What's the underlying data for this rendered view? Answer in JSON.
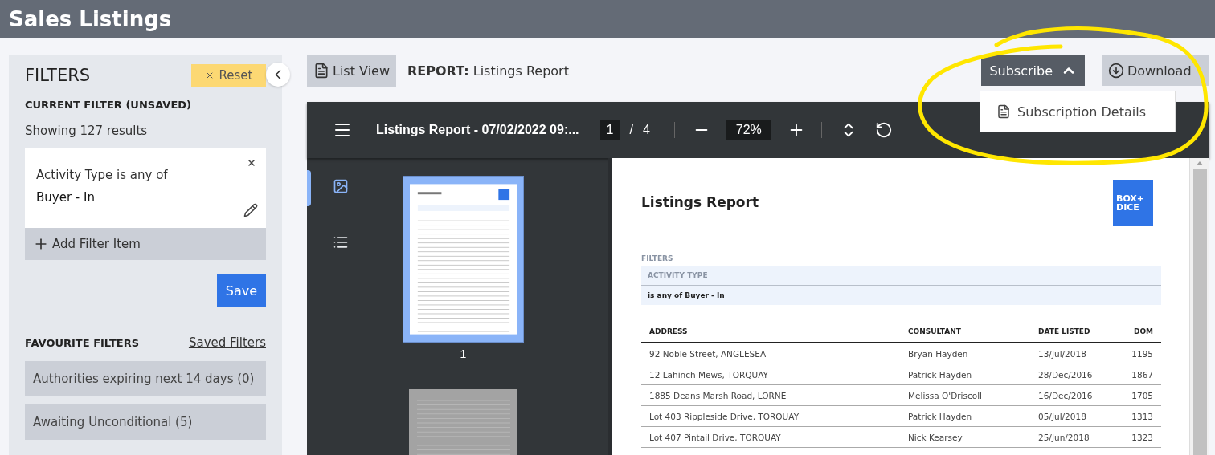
{
  "header": {
    "title": "Sales Listings"
  },
  "sidebar": {
    "title": "FILTERS",
    "reset": "Reset",
    "current_heading": "CURRENT FILTER (UNSAVED)",
    "result_count": "Showing 127 results",
    "filter_item": {
      "condition": "Activity Type is any of",
      "value": "Buyer - In"
    },
    "add_filter": "Add Filter Item",
    "save": "Save",
    "favourites_heading": "FAVOURITE FILTERS",
    "saved_filters_link": "Saved Filters",
    "favourites": [
      "Authorities expiring next 14 days (0)",
      "Awaiting Unconditional (5)"
    ]
  },
  "toolbar": {
    "list_view": "List View",
    "report_label": "REPORT:",
    "report_name": "Listings Report",
    "subscribe": {
      "label": "Subscribe",
      "expanded": true
    },
    "download": "Download",
    "menu": [
      "Subscription Details"
    ]
  },
  "viewer": {
    "title": "Listings Report - 07/02/2022 09:...",
    "page": "1",
    "separator": "/",
    "page_count": "4",
    "zoom": "72%",
    "sidebar_tabs": [
      {
        "kind": "thumbnails",
        "selected": true
      },
      {
        "kind": "outline",
        "selected": false
      }
    ],
    "thumbnails": [
      {
        "label": "1",
        "selected": true
      },
      {
        "selected": false
      }
    ],
    "document": {
      "title": "Listings Report",
      "logo": [
        "BOX+",
        "DICE"
      ],
      "filters_label": "FILTERS",
      "filter_name": "ACTIVITY TYPE",
      "filter_value": "is any of Buyer - In",
      "columns": [
        "ADDRESS",
        "CONSULTANT",
        "DATE LISTED",
        "DOM"
      ],
      "rows": [
        [
          "92 Noble Street, ANGLESEA",
          "Bryan Hayden",
          "13/Jul/2018",
          "1195"
        ],
        [
          "12 Lahinch Mews, TORQUAY",
          "Patrick Hayden",
          "28/Dec/2016",
          "1867"
        ],
        [
          "1885 Deans Marsh Road, LORNE",
          "Melissa O'Driscoll",
          "16/Dec/2016",
          "1705"
        ],
        [
          "Lot 403 Rippleside Drive, TORQUAY",
          "Patrick Hayden",
          "05/Jul/2018",
          "1313"
        ],
        [
          "Lot 407 Pintail Drive, TORQUAY",
          "Nick Kearsey",
          "25/Jun/2018",
          "1323"
        ]
      ]
    }
  }
}
